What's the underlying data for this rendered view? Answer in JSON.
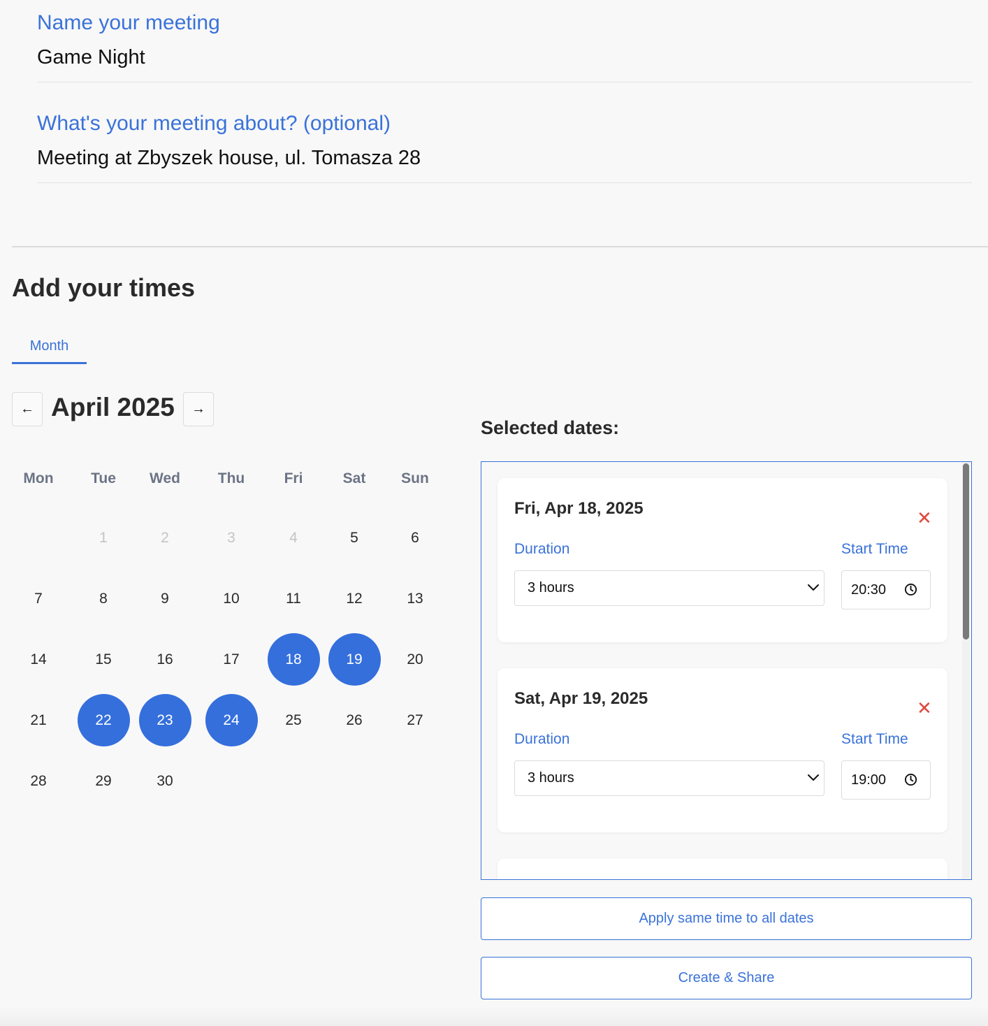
{
  "form": {
    "name_label": "Name your meeting",
    "name_value": "Game Night",
    "about_label": "What's your meeting about? (optional)",
    "about_value": "Meeting at Zbyszek house, ul. Tomasza 28"
  },
  "times": {
    "title": "Add your times",
    "tab_month": "Month"
  },
  "calendar": {
    "prev_icon": "arrow-left-icon",
    "next_icon": "arrow-right-icon",
    "month_title": "April 2025",
    "weekdays": [
      "Mon",
      "Tue",
      "Wed",
      "Thu",
      "Fri",
      "Sat",
      "Sun"
    ],
    "weeks": [
      [
        "",
        "1",
        "2",
        "3",
        "4",
        "5",
        "6"
      ],
      [
        "7",
        "8",
        "9",
        "10",
        "11",
        "12",
        "13"
      ],
      [
        "14",
        "15",
        "16",
        "17",
        "18",
        "19",
        "20"
      ],
      [
        "21",
        "22",
        "23",
        "24",
        "25",
        "26",
        "27"
      ],
      [
        "28",
        "29",
        "30",
        "",
        "",
        "",
        ""
      ]
    ],
    "disabled_days": [
      "1",
      "2",
      "3",
      "4"
    ],
    "selected_days": [
      "18",
      "19",
      "22",
      "23",
      "24"
    ],
    "accent_color": "#346fdc"
  },
  "selected": {
    "title": "Selected dates:",
    "cards": [
      {
        "date": "Fri, Apr 18, 2025",
        "duration_label": "Duration",
        "duration_value": "3 hours",
        "start_label": "Start Time",
        "start_value": "20:30"
      },
      {
        "date": "Sat, Apr 19, 2025",
        "duration_label": "Duration",
        "duration_value": "3 hours",
        "start_label": "Start Time",
        "start_value": "19:00"
      }
    ],
    "remove_icon": "close-icon",
    "remove_color": "#e0483c"
  },
  "actions": {
    "apply_label": "Apply same time to all dates",
    "create_label": "Create & Share"
  }
}
